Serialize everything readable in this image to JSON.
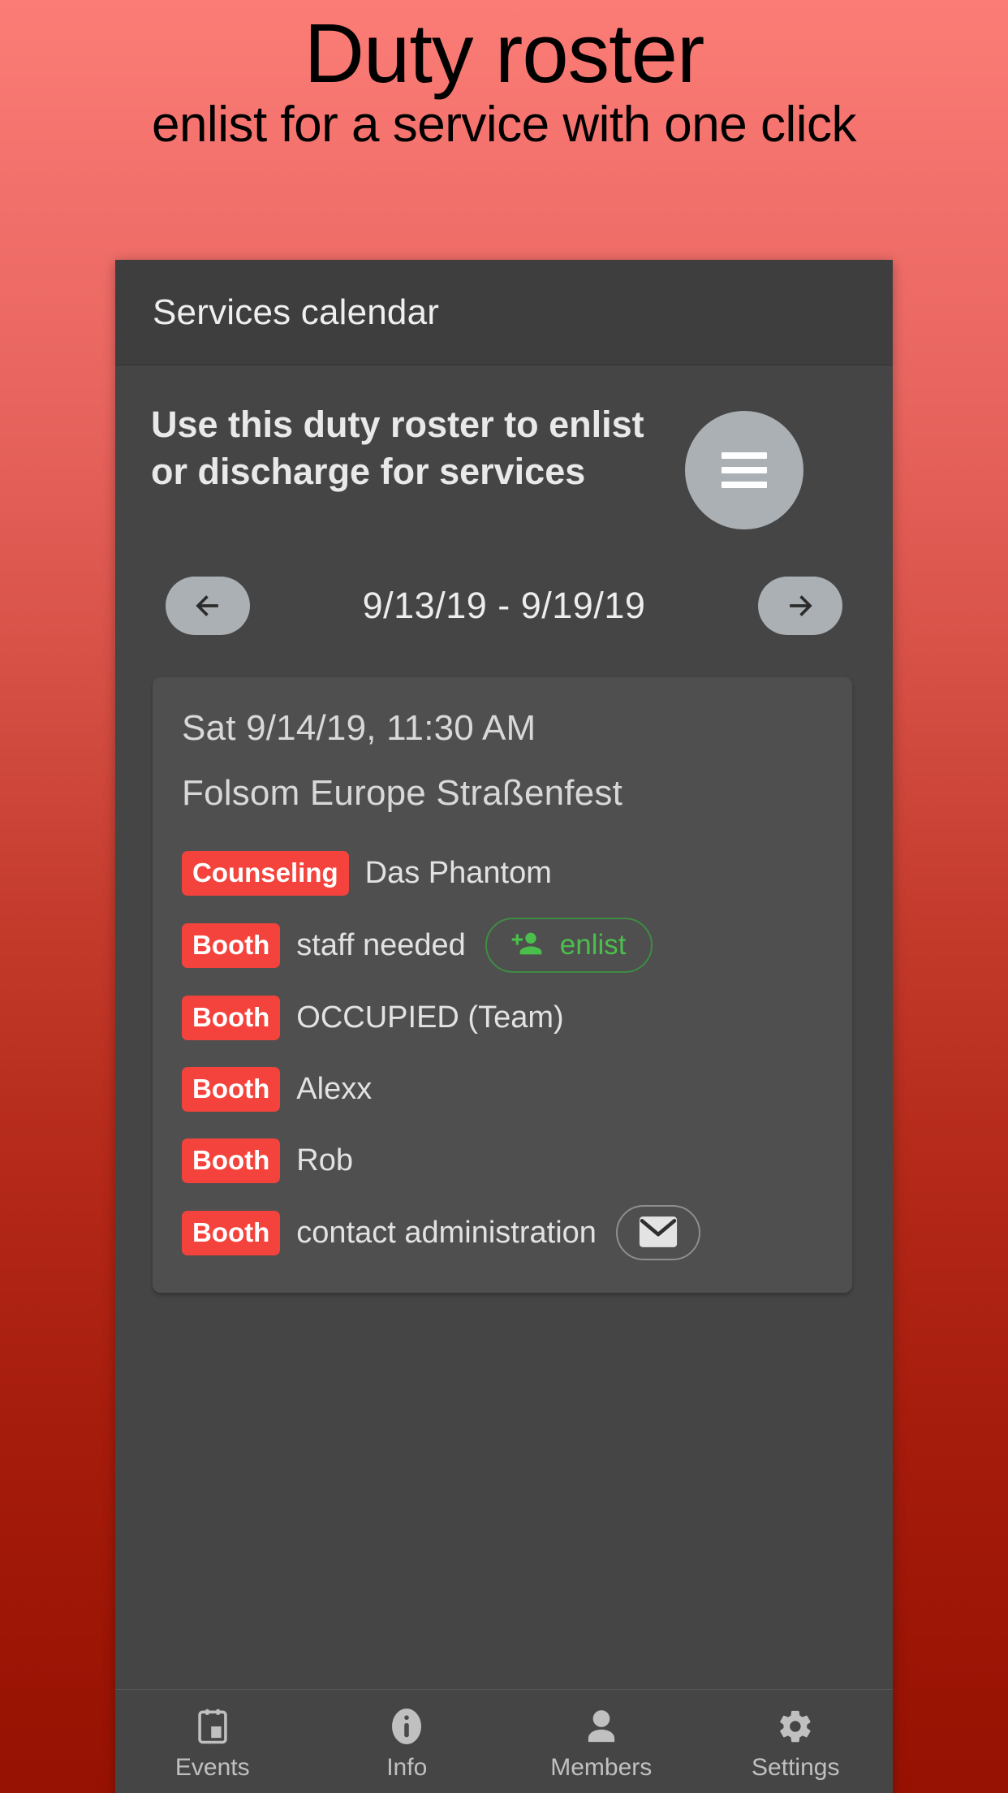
{
  "promo": {
    "title": "Duty roster",
    "subtitle": "enlist for a service with one click"
  },
  "app": {
    "appbar": {
      "title": "Services calendar",
      "menu_icon": "hamburger-menu-icon"
    },
    "intro": {
      "text": "Use this duty roster to enlist or discharge for services"
    },
    "week_nav": {
      "prev_icon": "arrow-left-icon",
      "next_icon": "arrow-right-icon",
      "range_label": "9/13/19 - 9/19/19"
    },
    "event_card": {
      "datetime": "Sat 9/14/19, 11:30 AM",
      "name": "Folsom Europe Straßenfest",
      "slots": [
        {
          "type": "Counseling",
          "assignee": "Das Phantom",
          "action": null
        },
        {
          "type": "Booth",
          "assignee": "staff needed",
          "action": {
            "kind": "enlist",
            "label": "enlist",
            "icon": "person-add-icon"
          }
        },
        {
          "type": "Booth",
          "assignee": "OCCUPIED (Team)",
          "action": null
        },
        {
          "type": "Booth",
          "assignee": "Alexx",
          "action": null
        },
        {
          "type": "Booth",
          "assignee": "Rob",
          "action": null
        },
        {
          "type": "Booth",
          "assignee": "contact administration",
          "action": {
            "kind": "mail",
            "label": "",
            "icon": "mail-icon"
          }
        }
      ]
    },
    "bottom_nav": [
      {
        "label": "Events",
        "icon": "calendar-icon"
      },
      {
        "label": "Info",
        "icon": "info-circle-icon"
      },
      {
        "label": "Members",
        "icon": "person-icon"
      },
      {
        "label": "Settings",
        "icon": "gear-icon"
      }
    ]
  },
  "colors": {
    "promo_gradient_top": "#FB7C76",
    "promo_gradient_bottom": "#971203",
    "app_background": "#454545",
    "appbar_background": "#3E3E3E",
    "card_background": "#4F4F4F",
    "chip_red": "#F4433C",
    "enlist_green": "#4BBF4B",
    "enlist_border_green": "#3E8C44",
    "circle_button_gray": "#ABB0B4"
  }
}
